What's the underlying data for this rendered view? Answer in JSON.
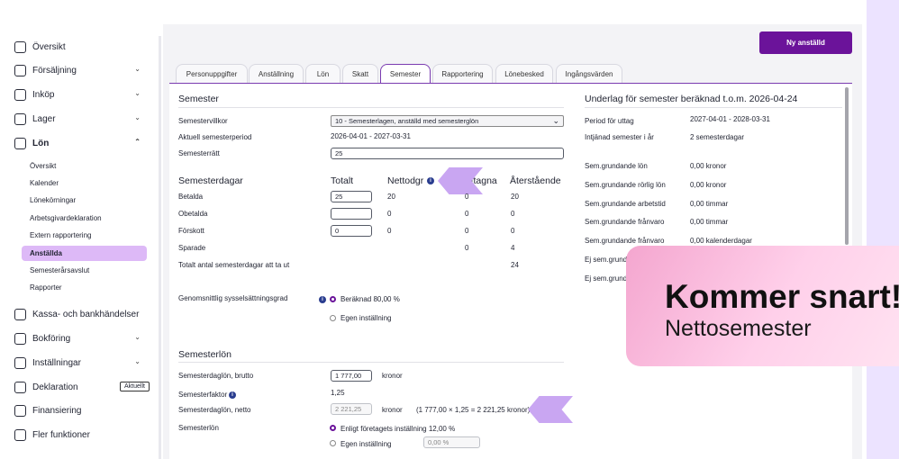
{
  "sidebar": {
    "items": [
      {
        "label": "Översikt"
      },
      {
        "label": "Försäljning"
      },
      {
        "label": "Inköp"
      },
      {
        "label": "Lager"
      },
      {
        "label": "Lön"
      }
    ],
    "lon_sub": [
      "Översikt",
      "Kalender",
      "Lönekörningar",
      "Arbetsgivardeklaration",
      "Extern rapportering",
      "Anställda",
      "Semesterårsavslut",
      "Rapporter"
    ],
    "items2": [
      {
        "label": "Kassa- och bankhändelser"
      },
      {
        "label": "Bokföring"
      },
      {
        "label": "Inställningar"
      },
      {
        "label": "Deklaration"
      },
      {
        "label": "Finansiering"
      },
      {
        "label": "Fler funktioner"
      }
    ],
    "badge": "Aktuellt"
  },
  "header": {
    "new_employee": "Ny anställd"
  },
  "tabs": [
    "Personuppgifter",
    "Anställning",
    "Lön",
    "Skatt",
    "Semester",
    "Rapportering",
    "Lönebesked",
    "Ingångsvärden"
  ],
  "semester": {
    "title": "Semester",
    "villkor_label": "Semestervillkor",
    "villkor_value": "10 - Semesterlagen, anställd med semesterglön",
    "period_label": "Aktuell semesterperiod",
    "period_value": "2026-04-01 - 2027-03-31",
    "ratt_label": "Semesterrätt",
    "ratt_value": "25"
  },
  "days": {
    "title": "Semesterdagar",
    "col_total": "Totalt",
    "col_netto": "Nettodgr",
    "col_uttagna": "Uttagna",
    "col_aterst": "Återstående",
    "rows": [
      {
        "label": "Betalda",
        "total": "25",
        "netto": "20",
        "uttagna": "0",
        "aterst": "20"
      },
      {
        "label": "Obetalda",
        "total": "",
        "netto": "0",
        "uttagna": "0",
        "aterst": "0"
      },
      {
        "label": "Förskott",
        "total": "0",
        "netto": "0",
        "uttagna": "0",
        "aterst": "0"
      },
      {
        "label": "Sparade",
        "uttagna": "0",
        "aterst": "4"
      }
    ],
    "total_label": "Totalt antal semesterdagar att ta ut",
    "total_value": "24"
  },
  "syss": {
    "label": "Genomsnittlig sysselsättningsgrad",
    "opt1": "Beräknad 80,00 %",
    "opt2": "Egen inställning"
  },
  "lon": {
    "title": "Semesterlön",
    "brutto_label": "Semesterdaglön, brutto",
    "brutto_value": "1 777,00",
    "unit": "kronor",
    "faktor_label": "Semesterfaktor",
    "faktor_value": "1,25",
    "netto_label": "Semesterdaglön, netto",
    "netto_value": "2 221,25",
    "netto_calc": "(1 777,00 × 1,25 = 2 221,25 kronor)",
    "semlon_label": "Semesterlön",
    "opt1": "Enligt företagets inställning 12,00 %",
    "opt2": "Egen inställning",
    "opt2_value": "0,00 %"
  },
  "underlag": {
    "title": "Underlag för semester beräknad t.o.m. 2026-04-24",
    "rows": [
      {
        "label": "Period för uttag",
        "value": "2027-04-01 - 2028-03-31"
      },
      {
        "label": "Intjänad semester i år",
        "value": "2 semesterdagar"
      },
      {
        "label": "Sem.grundande lön",
        "value": "0,00 kronor"
      },
      {
        "label": "Sem.grundande rörlig lön",
        "value": "0,00 kronor"
      },
      {
        "label": "Sem.grundande arbetstid",
        "value": "0,00 timmar"
      },
      {
        "label": "Sem.grundande frånvaro",
        "value": "0,00 timmar"
      },
      {
        "label": "Sem.grundande frånvaro",
        "value": "0,00 kalenderdagar"
      },
      {
        "label": "Ej sem.grund",
        "value": ""
      },
      {
        "label": "Ej sem.grund",
        "value": ""
      }
    ]
  },
  "promo": {
    "title": "Kommer snart!",
    "subtitle": "Nettosemester"
  },
  "colors": {
    "accent": "#6b139a",
    "active_nav": "#ddb9f7",
    "arrow": "#c9a6f2"
  }
}
